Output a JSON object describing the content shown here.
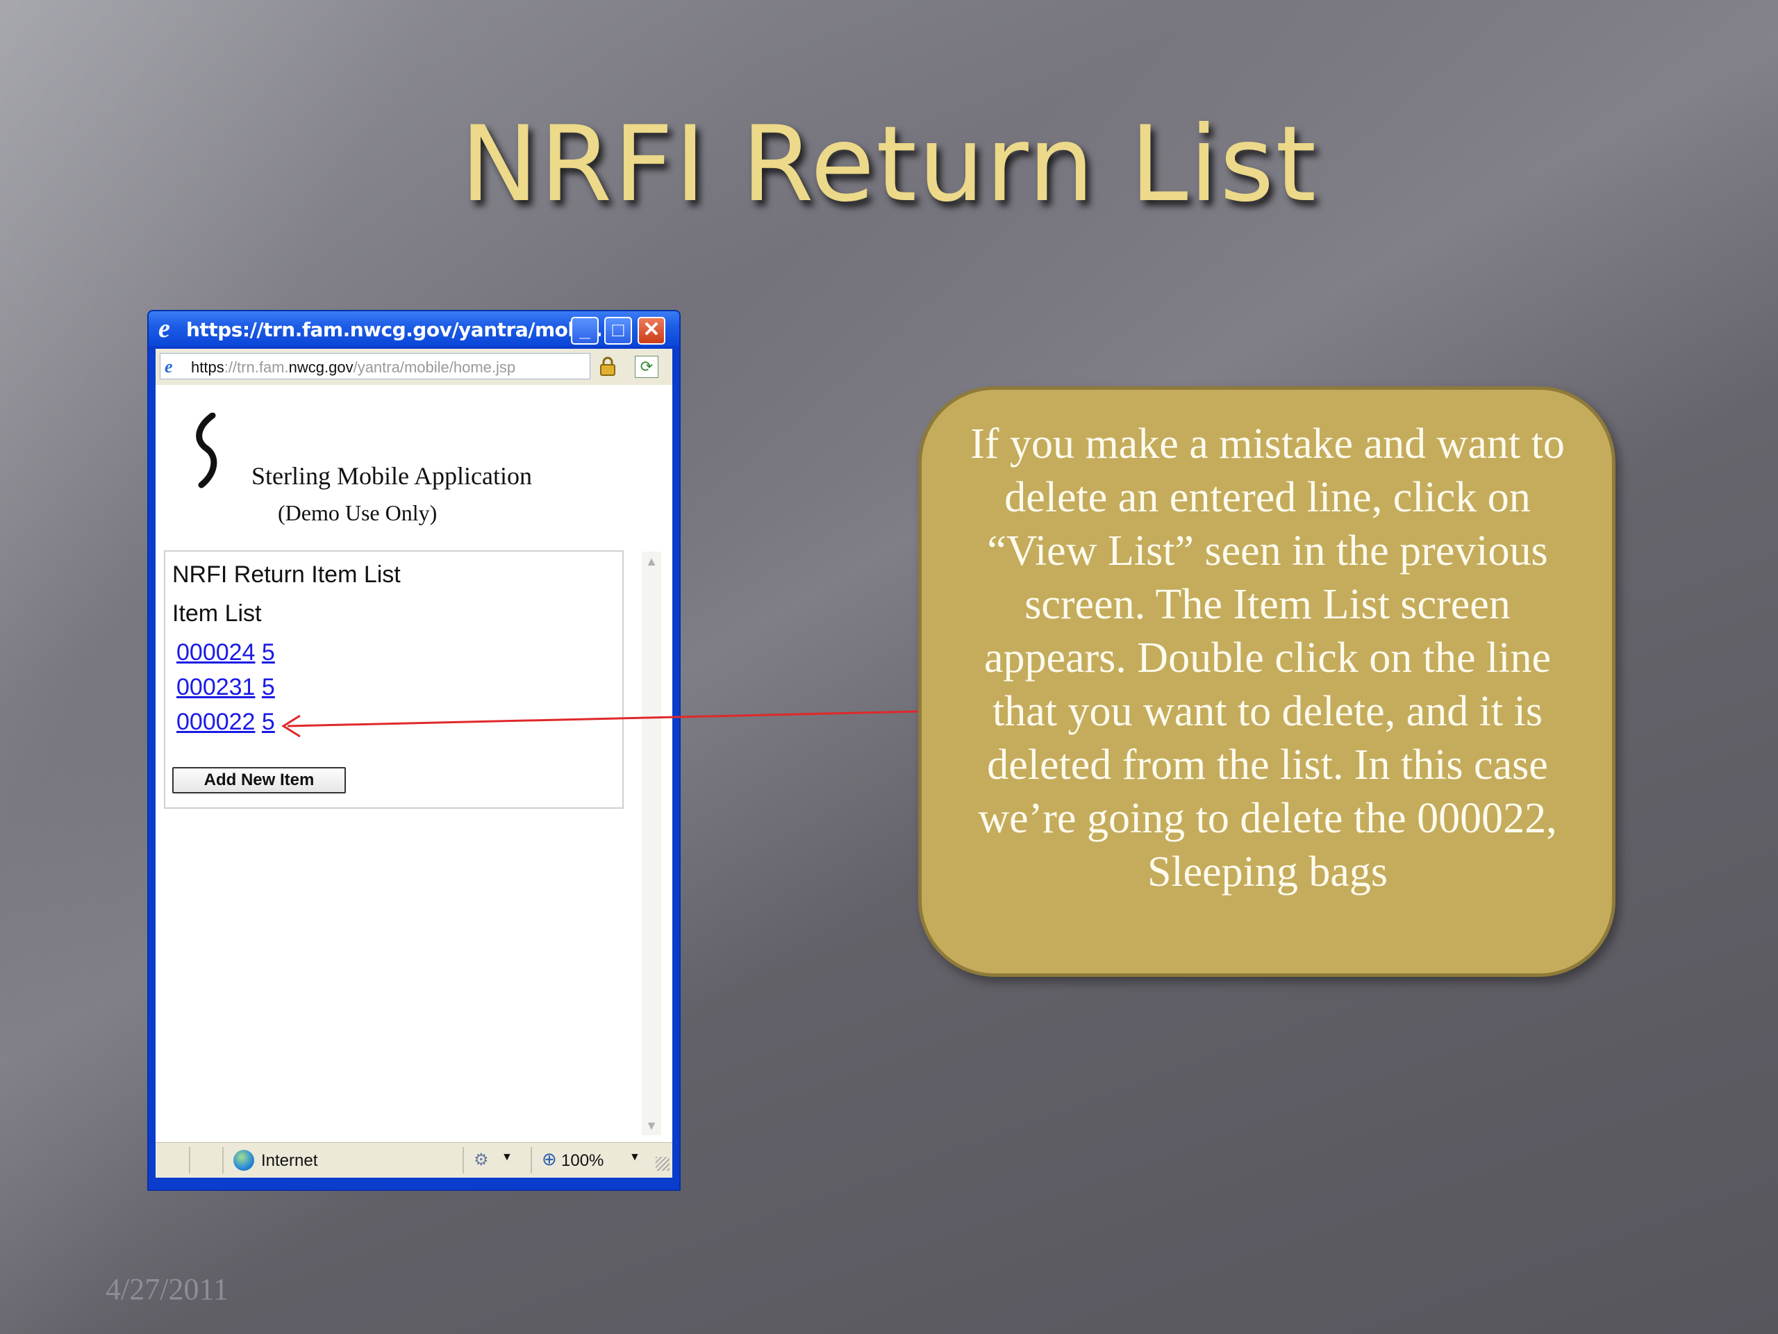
{
  "slide": {
    "title": "NRFI Return List",
    "date": "4/27/2011"
  },
  "browser": {
    "window_title": "https://trn.fam.nwcg.gov/yantra/mob...",
    "address": {
      "scheme": "https",
      "host_prefix": "://trn.fam.",
      "host": "nwcg.gov",
      "path": "/yantra/mobile/home.jsp"
    },
    "controls": {
      "minimize": "_",
      "maximize": "□",
      "close": "✕"
    },
    "status": {
      "zone": "Internet",
      "zoom": "100%"
    }
  },
  "app": {
    "name": "Sterling Mobile Application",
    "demo_note": "(Demo Use Only)",
    "form_title": "NRFI Return Item List",
    "item_list_label": "Item List",
    "items": [
      {
        "item_id": "000024",
        "qty": "5"
      },
      {
        "item_id": "000231",
        "qty": "5"
      },
      {
        "item_id": "000022",
        "qty": "5"
      }
    ],
    "add_button_label": "Add New Item"
  },
  "callout": {
    "text": "If you make a mistake and want to delete an entered line, click on “View List” seen in the previous screen. The Item List screen appears. Double click on the line that you want to delete, and it is deleted from the list.  In this case we’re going to delete the 000022, Sleeping bags"
  },
  "colors": {
    "title": "#ecd98a",
    "callout_fill": "#c4ac5c",
    "arrow": "#e0282a",
    "link": "#1a1ae6"
  }
}
